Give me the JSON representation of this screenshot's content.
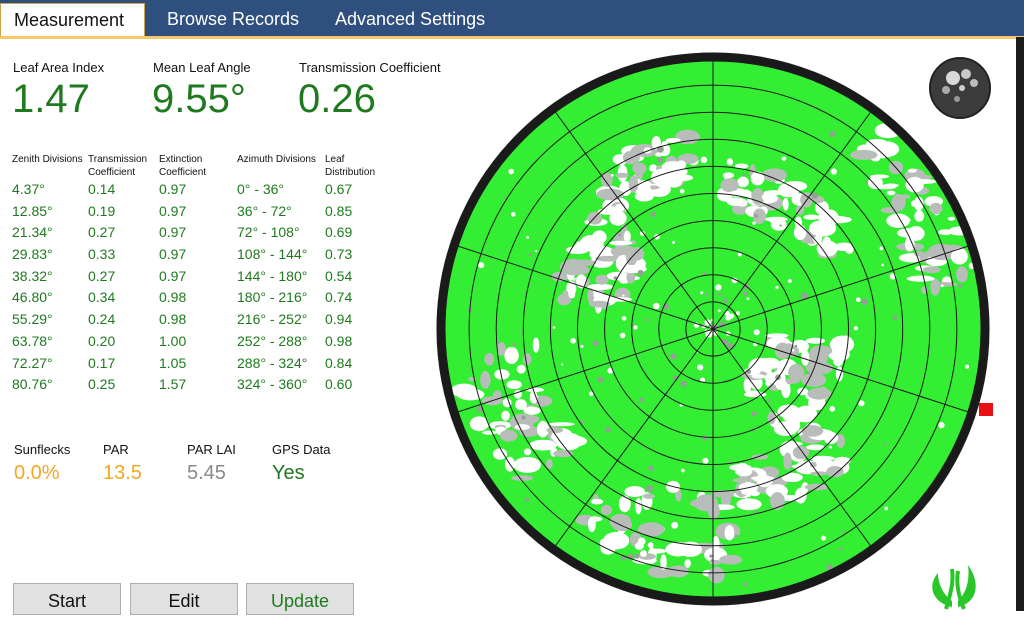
{
  "tabs": [
    {
      "label": "Measurement",
      "active": true
    },
    {
      "label": "Browse Records",
      "active": false
    },
    {
      "label": "Advanced Settings",
      "active": false
    }
  ],
  "metrics": {
    "lai": {
      "label": "Leaf Area Index",
      "value": "1.47"
    },
    "mla": {
      "label": "Mean Leaf Angle",
      "value": "9.55°"
    },
    "tc": {
      "label": "Transmission Coefficient",
      "value": "0.26"
    }
  },
  "table": {
    "headers": {
      "zenith": "Zenith Divisions",
      "transmission": "Transmission Coefficient",
      "extinction": "Extinction Coefficient",
      "azimuth": "Azimuth Divisions",
      "leaf": "Leaf Distribution"
    },
    "rows": [
      {
        "zenith": "4.37°",
        "transmission": "0.14",
        "extinction": "0.97",
        "azimuth": "0° - 36°",
        "leaf": "0.67"
      },
      {
        "zenith": "12.85°",
        "transmission": "0.19",
        "extinction": "0.97",
        "azimuth": "36° - 72°",
        "leaf": "0.85"
      },
      {
        "zenith": "21.34°",
        "transmission": "0.27",
        "extinction": "0.97",
        "azimuth": "72° - 108°",
        "leaf": "0.69"
      },
      {
        "zenith": "29.83°",
        "transmission": "0.33",
        "extinction": "0.97",
        "azimuth": "108° - 144°",
        "leaf": "0.73"
      },
      {
        "zenith": "38.32°",
        "transmission": "0.27",
        "extinction": "0.97",
        "azimuth": "144° - 180°",
        "leaf": "0.54"
      },
      {
        "zenith": "46.80°",
        "transmission": "0.34",
        "extinction": "0.98",
        "azimuth": "180° - 216°",
        "leaf": "0.74"
      },
      {
        "zenith": "55.29°",
        "transmission": "0.24",
        "extinction": "0.98",
        "azimuth": "216° - 252°",
        "leaf": "0.94"
      },
      {
        "zenith": "63.78°",
        "transmission": "0.20",
        "extinction": "1.00",
        "azimuth": "252° - 288°",
        "leaf": "0.98"
      },
      {
        "zenith": "72.27°",
        "transmission": "0.17",
        "extinction": "1.05",
        "azimuth": "288° - 324°",
        "leaf": "0.84"
      },
      {
        "zenith": "80.76°",
        "transmission": "0.25",
        "extinction": "1.57",
        "azimuth": "324° - 360°",
        "leaf": "0.60"
      }
    ]
  },
  "stats": {
    "sunflecks": {
      "label": "Sunflecks",
      "value": "0.0%"
    },
    "par": {
      "label": "PAR",
      "value": "13.5"
    },
    "par_lai": {
      "label": "PAR LAI",
      "value": "5.45"
    },
    "gps": {
      "label": "GPS Data",
      "value": "Yes"
    }
  },
  "buttons": {
    "start": "Start",
    "edit": "Edit",
    "update": "Update"
  },
  "colors": {
    "tab_bg": "#2f4f7e",
    "accent_green": "#1f7a1f",
    "canopy_green": "#33ee33",
    "orange": "#f5a623",
    "gray": "#8a8a8a",
    "marker_red": "#e81010"
  },
  "icons": {
    "thumbnail": "canopy-thumbnail",
    "logo": "leaf-logo-icon"
  },
  "plot": {
    "rings": 10,
    "sectors": 10
  }
}
